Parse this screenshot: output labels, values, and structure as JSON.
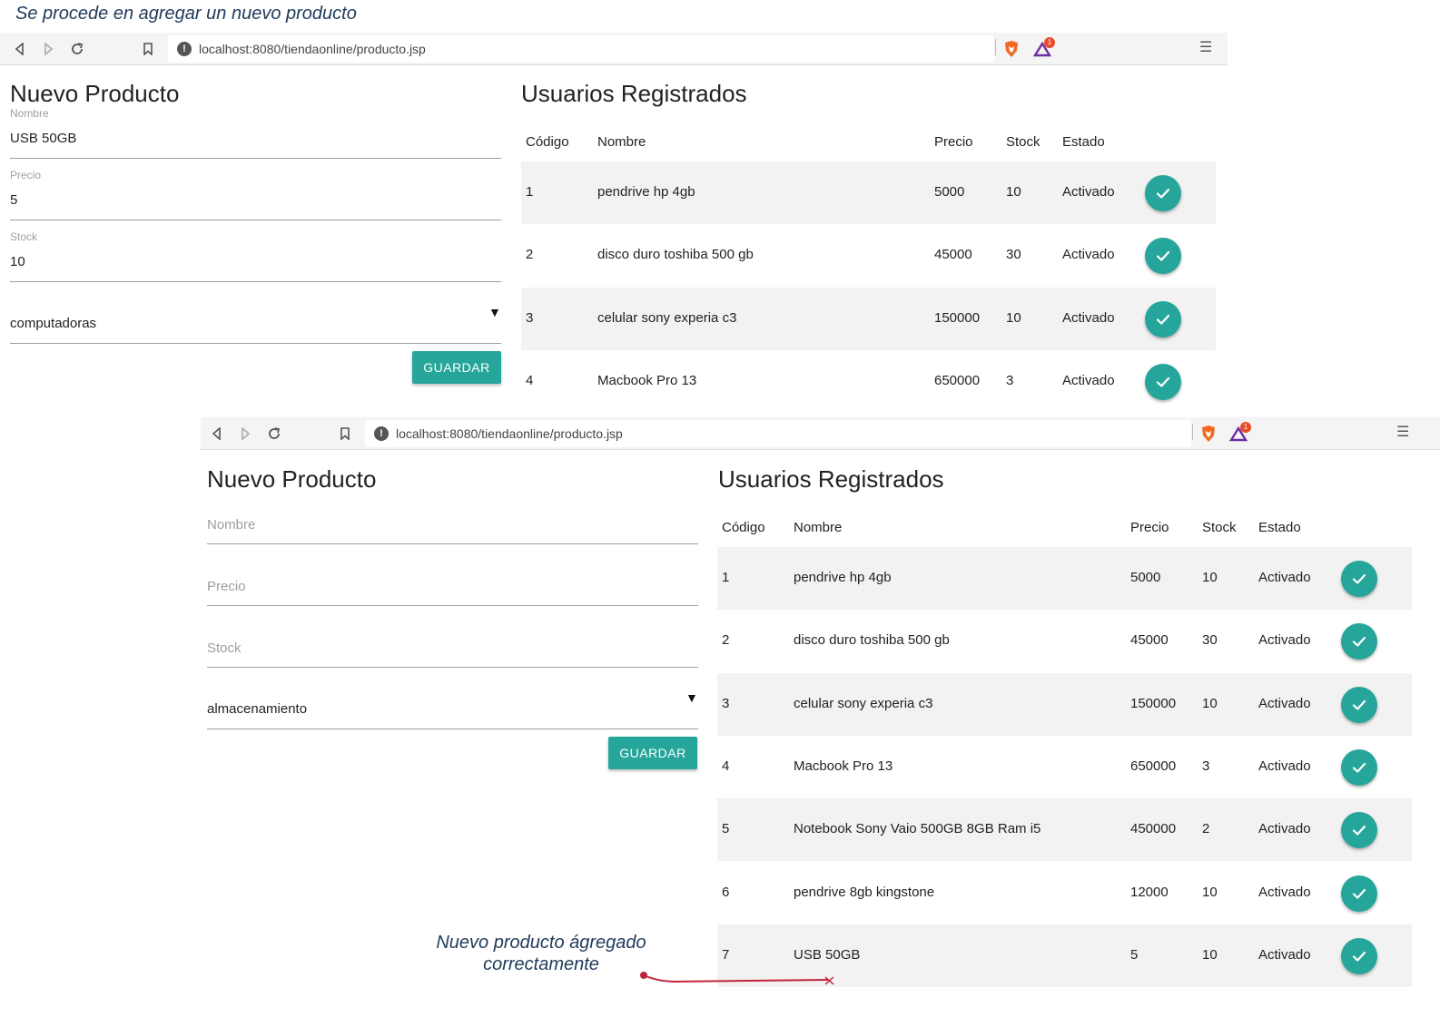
{
  "caption": "Se procede en agregar un nuevo producto",
  "browser": {
    "url": "localhost:8080/tiendaonline/producto.jsp",
    "rewards_badge": "1"
  },
  "annotation": {
    "line1": "Nuevo producto ágregado",
    "line2": "correctamente"
  },
  "colors": {
    "accent": "#26a69a",
    "caption": "#1f3a5a",
    "annotation_line": "#c0243a"
  },
  "shot1": {
    "form": {
      "title": "Nuevo Producto",
      "nombre_label": "Nombre",
      "nombre_value": "USB 50GB",
      "precio_label": "Precio",
      "precio_value": "5",
      "stock_label": "Stock",
      "stock_value": "10",
      "categoria_value": "computadoras",
      "save_label": "GUARDAR"
    },
    "table": {
      "title": "Usuarios Registrados",
      "headers": [
        "Código",
        "Nombre",
        "Precio",
        "Stock",
        "Estado"
      ],
      "rows": [
        [
          "1",
          "pendrive hp 4gb",
          "5000",
          "10",
          "Activado"
        ],
        [
          "2",
          "disco duro toshiba 500 gb",
          "45000",
          "30",
          "Activado"
        ],
        [
          "3",
          "celular sony experia c3",
          "150000",
          "10",
          "Activado"
        ],
        [
          "4",
          "Macbook Pro 13",
          "650000",
          "3",
          "Activado"
        ]
      ]
    }
  },
  "shot2": {
    "form": {
      "title": "Nuevo Producto",
      "nombre_placeholder": "Nombre",
      "precio_placeholder": "Precio",
      "stock_placeholder": "Stock",
      "categoria_value": "almacenamiento",
      "save_label": "GUARDAR"
    },
    "table": {
      "title": "Usuarios Registrados",
      "headers": [
        "Código",
        "Nombre",
        "Precio",
        "Stock",
        "Estado"
      ],
      "rows": [
        [
          "1",
          "pendrive hp 4gb",
          "5000",
          "10",
          "Activado"
        ],
        [
          "2",
          "disco duro toshiba 500 gb",
          "45000",
          "30",
          "Activado"
        ],
        [
          "3",
          "celular sony experia c3",
          "150000",
          "10",
          "Activado"
        ],
        [
          "4",
          "Macbook Pro 13",
          "650000",
          "3",
          "Activado"
        ],
        [
          "5",
          "Notebook Sony Vaio 500GB 8GB Ram i5",
          "450000",
          "2",
          "Activado"
        ],
        [
          "6",
          "pendrive 8gb kingstone",
          "12000",
          "10",
          "Activado"
        ],
        [
          "7",
          "USB 50GB",
          "5",
          "10",
          "Activado"
        ]
      ]
    }
  }
}
